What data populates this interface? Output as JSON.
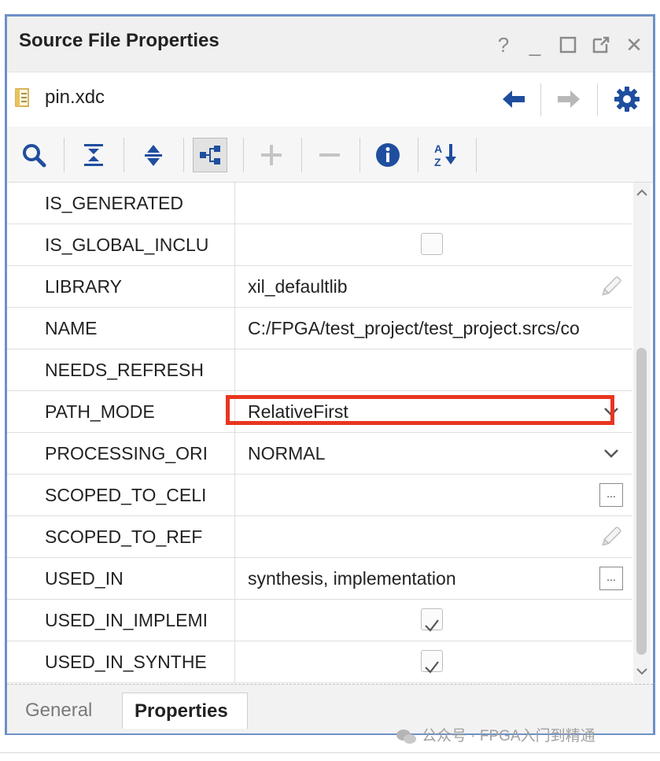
{
  "window": {
    "title": "Source File Properties",
    "controls": {
      "help": "?",
      "minimize": "_",
      "maximize": "☐",
      "restore": "⧉",
      "close": "✕"
    }
  },
  "file": {
    "name": "pin.xdc"
  },
  "toolbar": {
    "icons": [
      "search-icon",
      "collapse-all-icon",
      "expand-all-icon",
      "group-icon",
      "add-icon",
      "remove-icon",
      "info-icon",
      "sort-icon"
    ],
    "sort_label": "A↓Z"
  },
  "properties": [
    {
      "name": "IS_GENERATED",
      "value": "",
      "control": "none"
    },
    {
      "name": "IS_GLOBAL_INCLU",
      "value": "",
      "control": "checkbox",
      "checked": false
    },
    {
      "name": "LIBRARY",
      "value": "xil_defaultlib",
      "control": "pencil"
    },
    {
      "name": "NAME",
      "value": "C:/FPGA/test_project/test_project.srcs/co",
      "control": "none"
    },
    {
      "name": "NEEDS_REFRESH",
      "value": "",
      "control": "none"
    },
    {
      "name": "PATH_MODE",
      "value": "RelativeFirst",
      "control": "dropdown"
    },
    {
      "name": "PROCESSING_ORI",
      "value": "NORMAL",
      "control": "dropdown"
    },
    {
      "name": "SCOPED_TO_CELI",
      "value": "",
      "control": "ellipsis"
    },
    {
      "name": "SCOPED_TO_REF",
      "value": "",
      "control": "pencil"
    },
    {
      "name": "USED_IN",
      "value": "synthesis, implementation",
      "control": "ellipsis"
    },
    {
      "name": "USED_IN_IMPLEMI",
      "value": "",
      "control": "checkbox",
      "checked": true
    },
    {
      "name": "USED_IN_SYNTHE",
      "value": "",
      "control": "checkbox",
      "checked": true
    }
  ],
  "ellipsis_label": "...",
  "tabs": [
    {
      "label": "General",
      "active": false
    },
    {
      "label": "Properties",
      "active": true
    }
  ],
  "watermark": {
    "text": "公众号 · FPGA入门到精通"
  },
  "colors": {
    "window_border": "#6d90c8",
    "highlight": "#e8351f",
    "accent_blue": "#1f4e9e"
  }
}
